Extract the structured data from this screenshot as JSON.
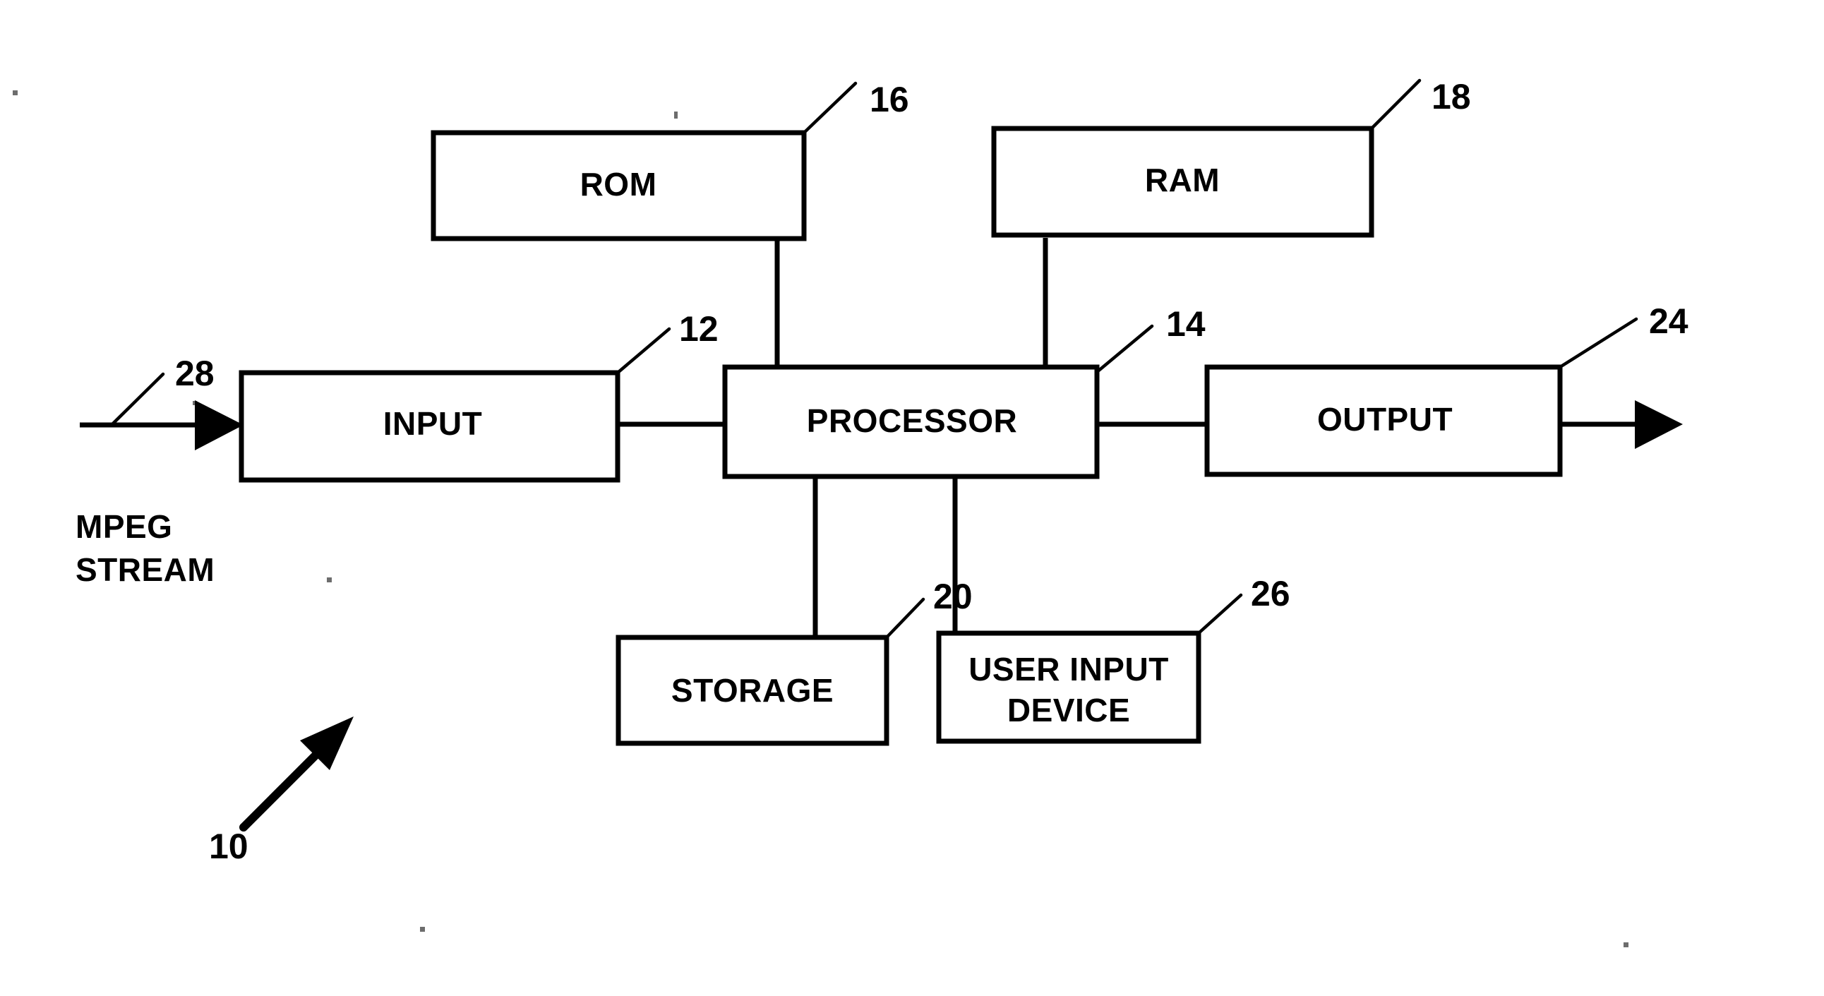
{
  "figure": {
    "type": "patent-block-diagram",
    "background_color": "#ffffff",
    "line_color": "#000000",
    "system_reference_numeral": "10"
  },
  "blocks": {
    "rom": {
      "label": "ROM",
      "ref": "16"
    },
    "ram": {
      "label": "RAM",
      "ref": "18"
    },
    "input": {
      "label": "INPUT",
      "ref": "12"
    },
    "processor": {
      "label": "PROCESSOR",
      "ref": "14"
    },
    "output": {
      "label": "OUTPUT",
      "ref": "24"
    },
    "storage": {
      "label": "STORAGE",
      "ref": "20"
    },
    "user_input_device": {
      "label_line1": "USER INPUT",
      "label_line2": "DEVICE",
      "ref": "26"
    }
  },
  "signals": {
    "input_stream": {
      "ref": "28",
      "caption_line1": "MPEG",
      "caption_line2": "STREAM"
    }
  },
  "reference_numerals": {
    "system": "10",
    "input": "12",
    "processor": "14",
    "rom": "16",
    "ram": "18",
    "storage": "20",
    "output": "24",
    "user_input_device": "26",
    "input_stream": "28"
  }
}
